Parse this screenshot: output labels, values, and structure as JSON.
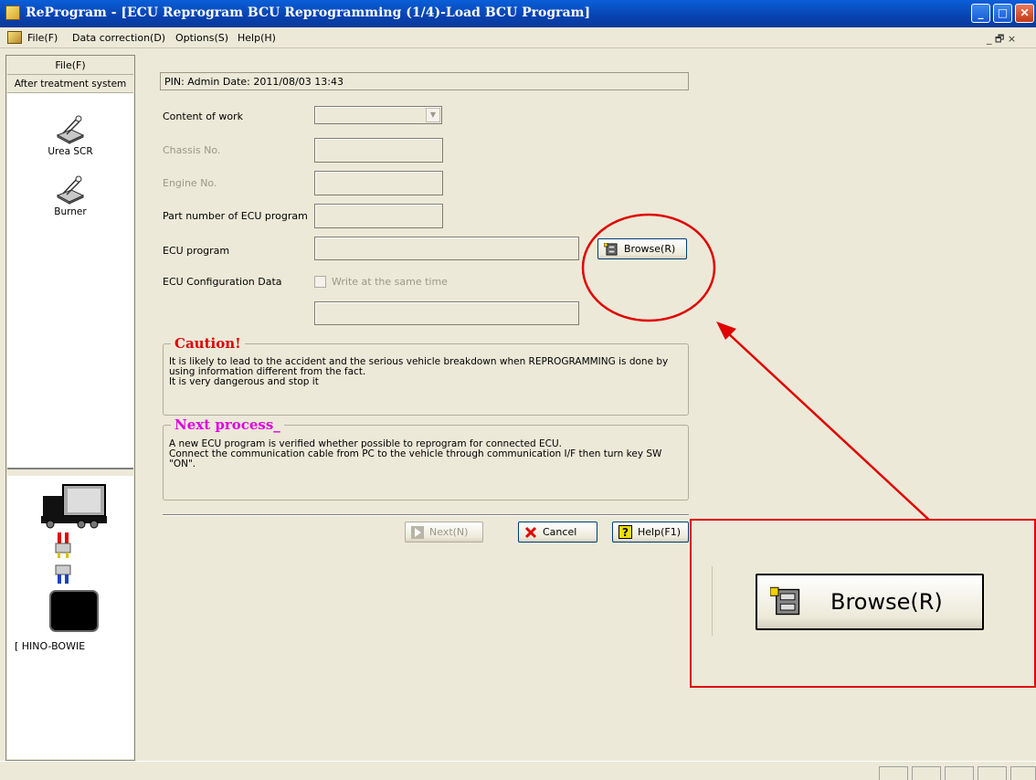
{
  "window": {
    "title": "ReProgram - [ECU Reprogram BCU Reprogramming (1/4)-Load BCU Program]",
    "minimize": "_",
    "maximize": "□",
    "close": "✕"
  },
  "menu": {
    "items": [
      "File(F)",
      "Data correction(D)",
      "Options(S)",
      "Help(H)"
    ],
    "mdi_controls": "_ 🗗 ×"
  },
  "sidebar": {
    "file_label": "File(F)",
    "section_label": "After treatment system",
    "items": [
      {
        "label": "Urea SCR",
        "icon": "machine-icon"
      },
      {
        "label": "Burner",
        "icon": "machine-icon"
      }
    ],
    "connection_label": "[ HINO-BOWIE"
  },
  "form": {
    "pin_info": "PIN: Admin  Date: 2011/08/03 13:43",
    "content_of_work_label": "Content of work",
    "chassis_label": "Chassis No.",
    "engine_label": "Engine No.",
    "part_number_label": "Part number of ECU program",
    "ecu_program_label": "ECU program",
    "browse_label": "Browse(R)",
    "ecu_config_label": "ECU Configuration Data",
    "write_same_time_label": "Write at the same time"
  },
  "caution": {
    "title": "Caution!",
    "text": "It is likely to lead to the accident and the serious vehicle breakdown when REPROGRAMMING is done by using information different from the fact.\nIt is very dangerous and stop it",
    "title_color": "#e00000"
  },
  "next_process": {
    "title": "Next process_",
    "text": "A new ECU program is verified whether possible to reprogram for connected ECU.\nConnect the communication cable from PC to the vehicle through communication I/F then turn key SW \"ON\".",
    "title_color": "#e000e0"
  },
  "buttons": {
    "next": "Next(N)",
    "cancel": "Cancel",
    "help": "Help(F1)"
  },
  "annotation": {
    "zoom_browse_label": "Browse(R)",
    "color": "#e00000"
  }
}
